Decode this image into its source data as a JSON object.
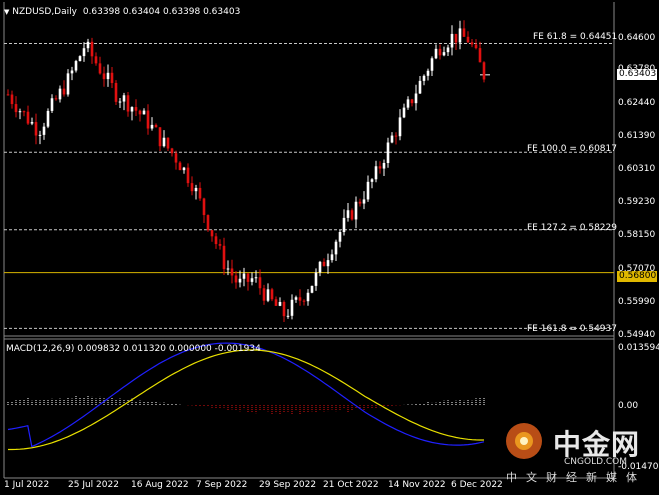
{
  "header": {
    "symbol": "NZDUSD,Daily",
    "ohlc": "0.63398 0.63404 0.63398 0.63403"
  },
  "price_axis": {
    "ticks": [
      "0.64600",
      "0.63780",
      "0.62440",
      "0.61390",
      "0.60310",
      "0.59230",
      "0.58150",
      "0.57070",
      "0.55990",
      "0.54940"
    ],
    "current_price": "0.63403",
    "marked_level": "0.56800"
  },
  "fib_levels": [
    {
      "label": "FE 61.8 = 0.64451"
    },
    {
      "label": "FE 100.0 = 0.60817"
    },
    {
      "label": "FE 127.2 = 0.58229"
    },
    {
      "label": "FE 161.8 = 0.54937"
    }
  ],
  "macd": {
    "label": "MACD(12,26,9) 0.009832 0.011320 0.000000 -0.001934",
    "ticks": [
      "0.013594",
      "0.00",
      "-0.014703"
    ]
  },
  "date_axis": [
    "1 Jul 2022",
    "25 Jul 2022",
    "16 Aug 2022",
    "7 Sep 2022",
    "29 Sep 2022",
    "21 Oct 2022",
    "14 Nov 2022",
    "6 Dec 2022"
  ],
  "watermark": {
    "brand_cn": "中金网",
    "brand_en": "CNGOLD.COM",
    "sub_cn": "中文财经新媒体"
  },
  "colors": {
    "bull": "#ffffff",
    "bear": "#e01010",
    "grid": "#c8c8c8",
    "level_line": "#d8b400",
    "macd_line": "#2020ff",
    "signal_line": "#e8e000"
  },
  "chart_data": {
    "type": "candlestick",
    "title": "NZDUSD,Daily",
    "ylim": [
      0.5475,
      0.651
    ],
    "x": [
      "1 Jul 2022",
      "25 Jul 2022",
      "16 Aug 2022",
      "7 Sep 2022",
      "29 Sep 2022",
      "21 Oct 2022",
      "14 Nov 2022",
      "6 Dec 2022"
    ],
    "approx_path": [
      0.6275,
      0.621,
      0.6155,
      0.6245,
      0.633,
      0.644,
      0.636,
      0.628,
      0.624,
      0.619,
      0.612,
      0.606,
      0.598,
      0.585,
      0.572,
      0.564,
      0.566,
      0.559,
      0.554,
      0.559,
      0.566,
      0.576,
      0.585,
      0.593,
      0.601,
      0.613,
      0.623,
      0.633,
      0.643,
      0.647,
      0.646,
      0.634
    ]
  }
}
